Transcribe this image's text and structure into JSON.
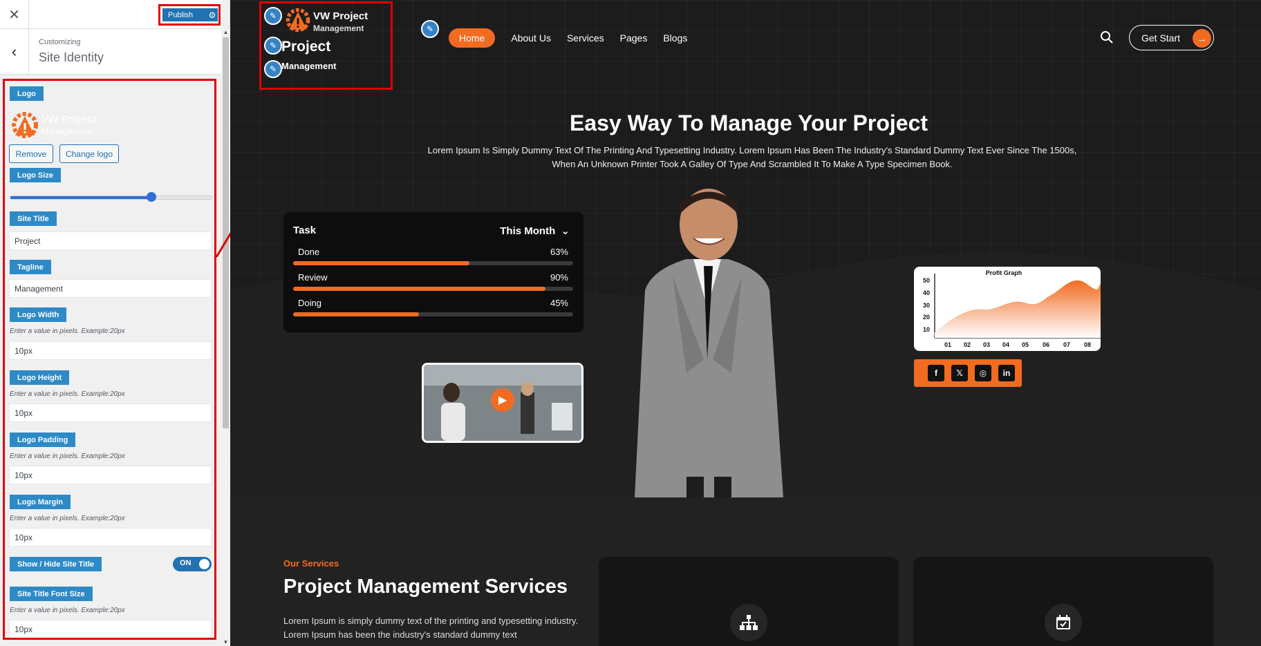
{
  "customizer": {
    "close_icon": "close-icon",
    "publish_label": "Publish",
    "customizing_label": "Customizing",
    "section_title": "Site Identity",
    "logo_label": "Logo",
    "remove_label": "Remove",
    "change_logo_label": "Change logo",
    "logo_size_label": "Logo Size",
    "logo_size_value": 0.7,
    "site_title_label": "Site Title",
    "site_title_value": "Project",
    "tagline_label": "Tagline",
    "tagline_value": "Management",
    "logo_width_label": "Logo Width",
    "logo_width_help": "Enter a value in pixels. Example:20px",
    "logo_width_value": "10px",
    "logo_height_label": "Logo Height",
    "logo_height_help": "Enter a value in pixels. Example:20px",
    "logo_height_value": "10px",
    "logo_padding_label": "Logo Padding",
    "logo_padding_help": "Enter a value in pixels. Example:20px",
    "logo_padding_value": "10px",
    "logo_margin_label": "Logo Margin",
    "logo_margin_help": "Enter a value in pixels. Example:20px",
    "logo_margin_value": "10px",
    "show_hide_label": "Show / Hide Site Title",
    "toggle_label": "ON",
    "title_font_label": "Site Title Font Size",
    "title_font_help": "Enter a value in pixels. Example:20px",
    "title_font_value": "10px",
    "mini_logo_line1": "VW Project",
    "mini_logo_line2": "Management"
  },
  "site": {
    "logo_line1": "VW Project",
    "logo_line2": "Management",
    "title": "Project",
    "tagline": "Management",
    "nav": [
      "Home",
      "About Us",
      "Services",
      "Pages",
      "Blogs"
    ],
    "get_start": "Get Start",
    "hero_title": "Easy Way To Manage Your Project",
    "hero_text": "Lorem Ipsum Is Simply Dummy Text Of The Printing And Typesetting Industry. Lorem Ipsum Has Been The Industry's Standard Dummy Text Ever Since The 1500s, When An Unknown Printer Took A Galley Of Type And Scrambled It To Make A Type Specimen Book.",
    "task": {
      "title": "Task",
      "period": "This Month",
      "rows": [
        {
          "name": "Done",
          "pct": "63%",
          "value": 63
        },
        {
          "name": "Review",
          "pct": "90%",
          "value": 90
        },
        {
          "name": "Doing",
          "pct": "45%",
          "value": 45
        }
      ]
    },
    "profit": {
      "title": "Profit Graph",
      "y_ticks": [
        "50",
        "40",
        "30",
        "20",
        "10"
      ],
      "x_ticks": [
        "01",
        "02",
        "03",
        "04",
        "05",
        "06",
        "07",
        "08"
      ]
    },
    "social": [
      "facebook-icon",
      "x-icon",
      "instagram-icon",
      "linkedin-icon"
    ],
    "services_kicker": "Our Services",
    "services_title": "Project Management Services",
    "services_text": "Lorem Ipsum is simply dummy text of the printing and typesetting industry. Lorem Ipsum has been the industry's standard dummy text",
    "colors": {
      "accent": "#f26b21",
      "wp_blue": "#2271b1",
      "highlight": "#e00000"
    }
  }
}
